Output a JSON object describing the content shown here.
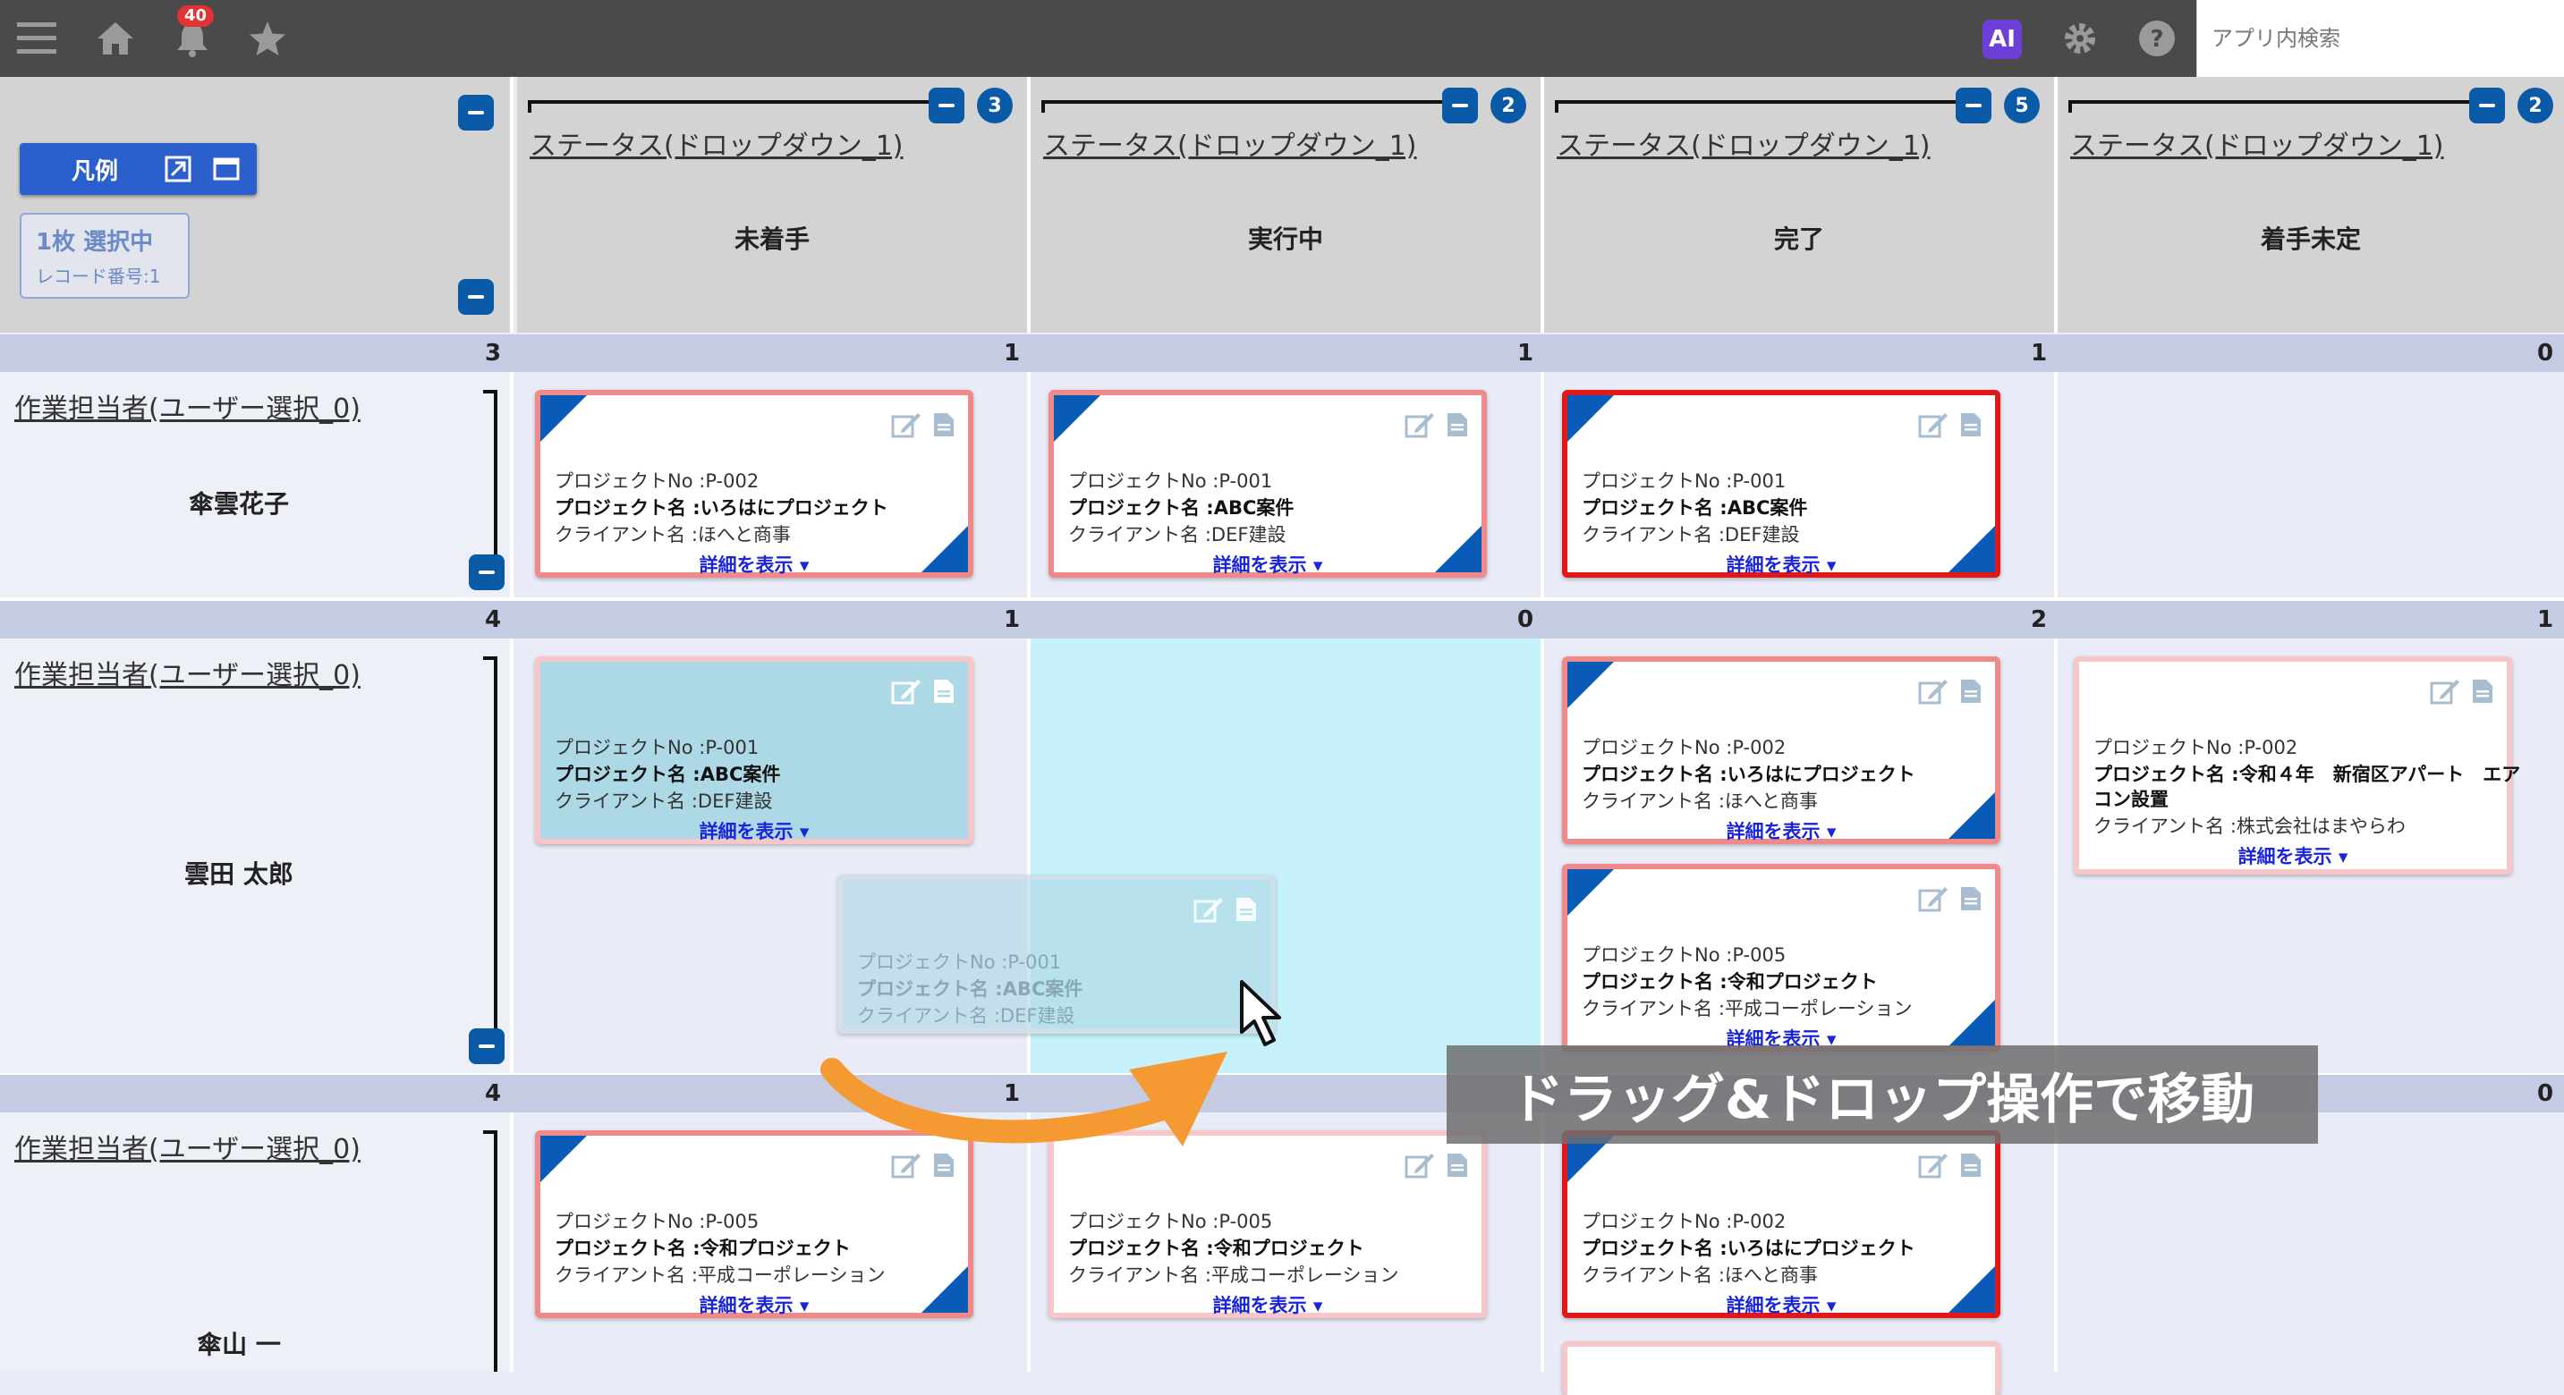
{
  "search": {
    "placeholder": "アプリ内検索"
  },
  "notifications": {
    "count": "40"
  },
  "ai_label": "AI",
  "legend": {
    "label": "凡例"
  },
  "selection": {
    "line1": "1枚 選択中",
    "line2": "レコード番号:1"
  },
  "columns": [
    {
      "field": "ステータス(ドロップダウン_1)",
      "status": "未着手",
      "count": "3"
    },
    {
      "field": "ステータス(ドロップダウン_1)",
      "status": "実行中",
      "count": "2"
    },
    {
      "field": "ステータス(ドロップダウン_1)",
      "status": "完了",
      "count": "5"
    },
    {
      "field": "ステータス(ドロップダウン_1)",
      "status": "着手未定",
      "count": "2"
    }
  ],
  "lanes": [
    {
      "total": "3",
      "field": "作業担当者(ユーザー選択_0)",
      "person": "傘雲花子",
      "cell_counts": [
        "1",
        "1",
        "1",
        "0"
      ]
    },
    {
      "total": "4",
      "field": "作業担当者(ユーザー選択_0)",
      "person": "雲田 太郎",
      "cell_counts": [
        "1",
        "0",
        "2",
        "1"
      ]
    },
    {
      "total": "4",
      "field": "作業担当者(ユーザー選択_0)",
      "person": "傘山 一",
      "cell_counts": [
        "1",
        "",
        "",
        "0"
      ]
    }
  ],
  "labels": {
    "project_no": "プロジェクトNo :",
    "project_name": "プロジェクト名 :",
    "client": "クライアント名 :",
    "details": "詳細を表示 ▾"
  },
  "cards": [
    {
      "no": "P-002",
      "name": "いろはにプロジェクト",
      "client": "ほへと商事"
    },
    {
      "no": "P-001",
      "name": "ABC案件",
      "client": "DEF建設"
    },
    {
      "no": "P-001",
      "name": "ABC案件",
      "client": "DEF建設"
    },
    {
      "no": "P-001",
      "name": "ABC案件",
      "client": "DEF建設"
    },
    {
      "no": "P-002",
      "name": "いろはにプロジェクト",
      "client": "ほへと商事"
    },
    {
      "no": "P-002",
      "name": "令和４年　新宿区アパート　エアコン設置",
      "name_l1": "令和４年　新宿区アパート　エア",
      "name_l2": "コン設置",
      "client": "株式会社はまやらわ"
    },
    {
      "no": "P-005",
      "name": "令和プロジェクト",
      "client": "平成コーポレーション"
    },
    {
      "no": "P-001",
      "name": "ABC案件",
      "client": "DEF建設"
    },
    {
      "no": "P-005",
      "name": "令和プロジェクト",
      "client": "平成コーポレーション"
    },
    {
      "no": "P-005",
      "name": "令和プロジェクト",
      "client": "平成コーポレーション"
    },
    {
      "no": "P-002",
      "name": "いろはにプロジェクト",
      "client": "ほへと商事"
    }
  ],
  "overlay": {
    "text": "ドラッグ&ドロップ操作で移動"
  },
  "colors": {
    "accent": "#0a5aa8",
    "card_border": "#f08a8a",
    "selected_border": "#e01818",
    "drop_target": "#c8f2fb",
    "arrow": "#f59a32"
  }
}
